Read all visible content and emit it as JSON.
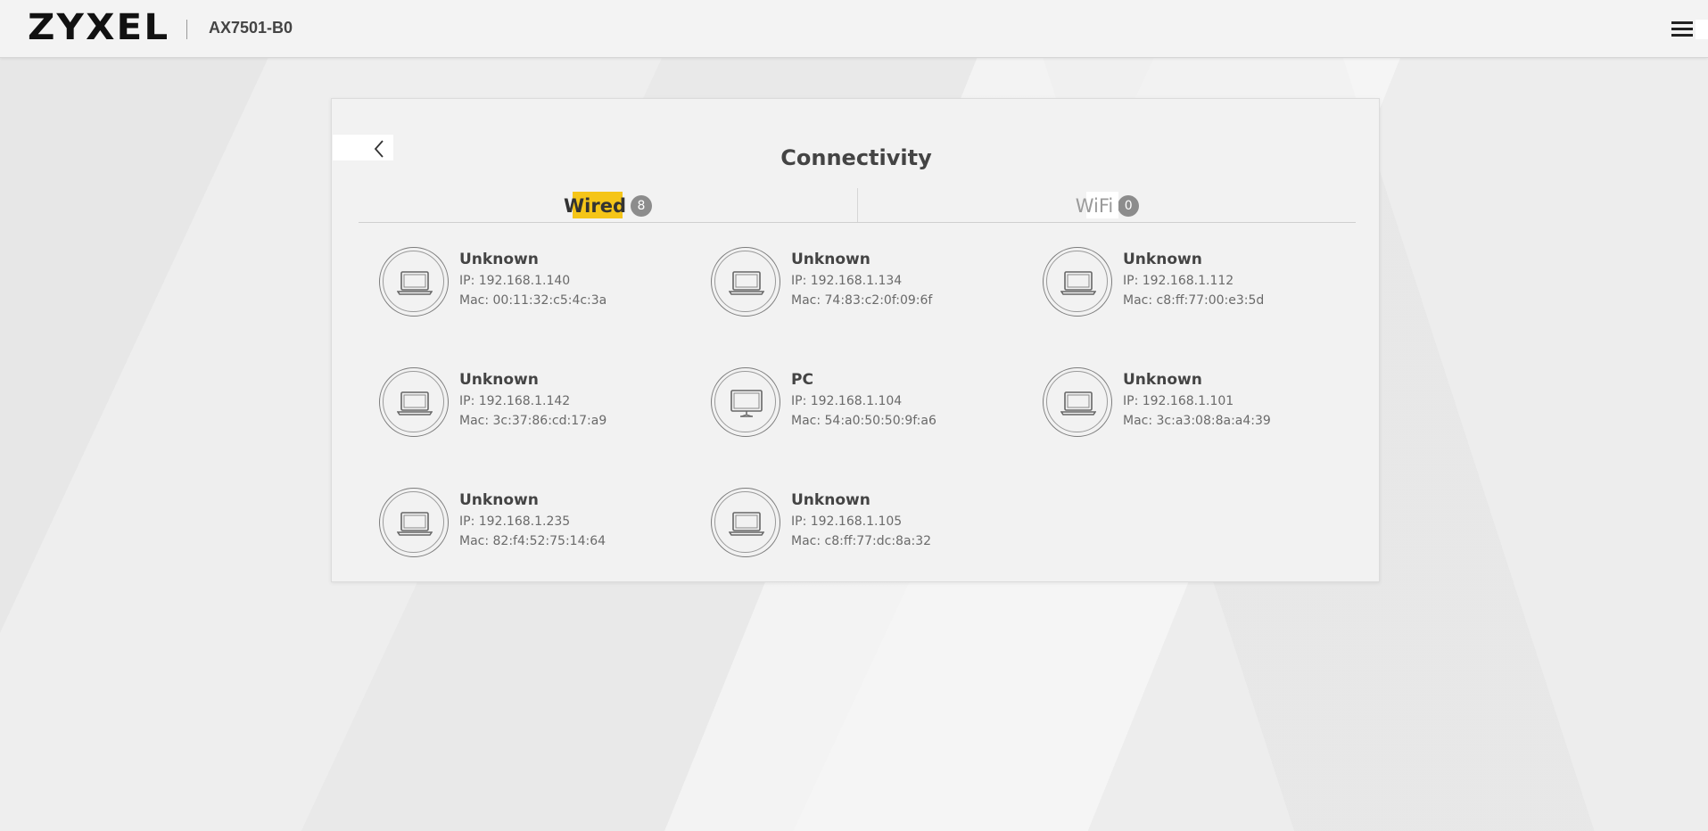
{
  "header": {
    "logo": "ZYXEL",
    "model": "AX7501-B0",
    "menu_icon": "hamburger-menu-icon"
  },
  "page": {
    "title": "Connectivity",
    "back_icon": "chevron-left-icon"
  },
  "tabs": [
    {
      "label": "Wired",
      "count": "8",
      "active": true
    },
    {
      "label": "WiFi",
      "count": "0",
      "active": false
    }
  ],
  "colors": {
    "accent": "#f5c518",
    "badge": "#8c8c8c",
    "text": "#444444"
  },
  "devices": [
    {
      "name": "Unknown",
      "ip": "IP: 192.168.1.140",
      "mac": "Mac: 00:11:32:c5:4c:3a",
      "icon": "laptop-icon"
    },
    {
      "name": "Unknown",
      "ip": "IP: 192.168.1.134",
      "mac": "Mac: 74:83:c2:0f:09:6f",
      "icon": "laptop-icon"
    },
    {
      "name": "Unknown",
      "ip": "IP: 192.168.1.112",
      "mac": "Mac: c8:ff:77:00:e3:5d",
      "icon": "laptop-icon"
    },
    {
      "name": "Unknown",
      "ip": "IP: 192.168.1.142",
      "mac": "Mac: 3c:37:86:cd:17:a9",
      "icon": "laptop-icon"
    },
    {
      "name": "PC",
      "ip": "IP: 192.168.1.104",
      "mac": "Mac: 54:a0:50:50:9f:a6",
      "icon": "monitor-icon"
    },
    {
      "name": "Unknown",
      "ip": "IP: 192.168.1.101",
      "mac": "Mac: 3c:a3:08:8a:a4:39",
      "icon": "laptop-icon"
    },
    {
      "name": "Unknown",
      "ip": "IP: 192.168.1.235",
      "mac": "Mac: 82:f4:52:75:14:64",
      "icon": "laptop-icon"
    },
    {
      "name": "Unknown",
      "ip": "IP: 192.168.1.105",
      "mac": "Mac: c8:ff:77:dc:8a:32",
      "icon": "laptop-icon"
    }
  ]
}
